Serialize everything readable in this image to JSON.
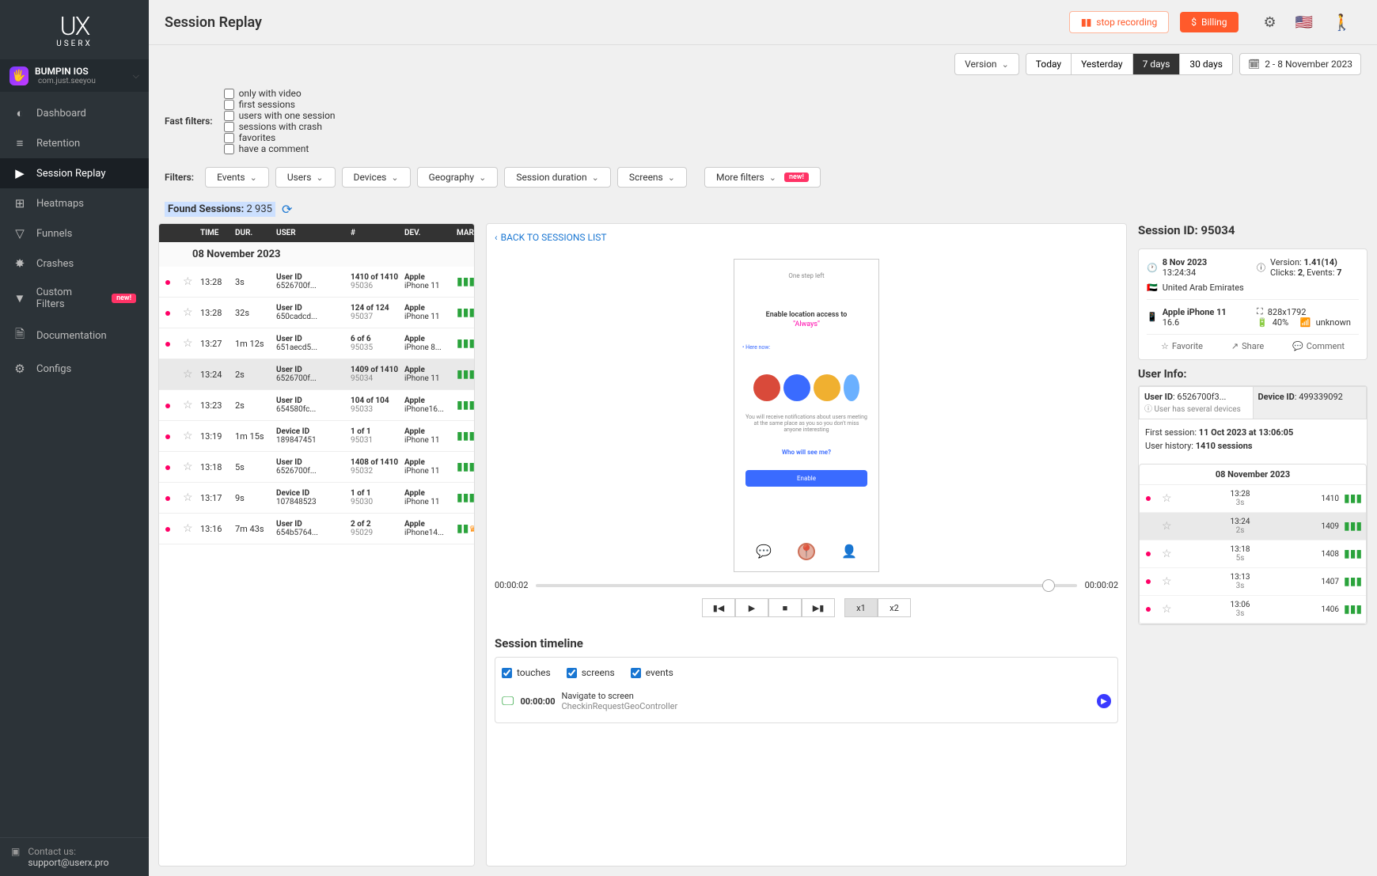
{
  "logo": {
    "mark": "UX",
    "text": "USERX"
  },
  "appSelector": {
    "name": "BUMPIN IOS",
    "bundle": "com.just.seeyou",
    "platformIcon": ""
  },
  "nav": [
    {
      "icon": "◐",
      "label": "Dashboard"
    },
    {
      "icon": "≡",
      "label": "Retention"
    },
    {
      "icon": "▶",
      "label": "Session Replay",
      "active": true
    },
    {
      "icon": "⊞",
      "label": "Heatmaps"
    },
    {
      "icon": "▽",
      "label": "Funnels"
    },
    {
      "icon": "✸",
      "label": "Crashes"
    },
    {
      "icon": "▼",
      "label": "Custom Filters",
      "badge": "new!"
    },
    {
      "icon": "🗎",
      "label": "Documentation"
    },
    {
      "icon": "⚙",
      "label": "Configs"
    }
  ],
  "support": {
    "label": "Contact us:",
    "email": "support@userx.pro"
  },
  "header": {
    "title": "Session Replay",
    "stop": "stop recording",
    "billing": "Billing"
  },
  "versionLabel": "Version",
  "dateRange": {
    "options": [
      "Today",
      "Yesterday",
      "7 days",
      "30 days"
    ],
    "active": "7 days",
    "custom": "2 - 8 November 2023"
  },
  "fastFilters": {
    "label": "Fast filters:",
    "items": [
      "only with video",
      "first sessions",
      "users with one session",
      "sessions with crash",
      "favorites",
      "have a comment"
    ]
  },
  "filters": {
    "label": "Filters:",
    "items": [
      "Events",
      "Users",
      "Devices",
      "Geography",
      "Session duration",
      "Screens"
    ],
    "more": "More filters",
    "moreBadge": "new!"
  },
  "found": {
    "label": "Found Sessions:",
    "count": "2 935"
  },
  "tableHead": [
    "",
    "",
    "TIME",
    "DUR.",
    "USER",
    "#",
    "DEV.",
    "MARKS"
  ],
  "dateHeader": "08 November 2023",
  "sessions": [
    {
      "dot": true,
      "time": "13:28",
      "dur": "3s",
      "uidLabel": "User ID",
      "uid": "6526700f...",
      "num": "1410 of 1410",
      "sid": "95036",
      "brand": "Apple",
      "dev": "iPhone 11"
    },
    {
      "dot": true,
      "time": "13:28",
      "dur": "32s",
      "uidLabel": "User ID",
      "uid": "650cadcd...",
      "num": "124 of 124",
      "sid": "95037",
      "brand": "Apple",
      "dev": "iPhone 11"
    },
    {
      "dot": true,
      "time": "13:27",
      "dur": "1m 12s",
      "uidLabel": "User ID",
      "uid": "651aecd5...",
      "num": "6 of 6",
      "sid": "95035",
      "brand": "Apple",
      "dev": "iPhone 8..."
    },
    {
      "dot": false,
      "time": "13:24",
      "dur": "2s",
      "uidLabel": "User ID",
      "uid": "6526700f...",
      "num": "1409 of 1410",
      "sid": "95034",
      "brand": "Apple",
      "dev": "iPhone 11",
      "selected": true
    },
    {
      "dot": true,
      "time": "13:23",
      "dur": "2s",
      "uidLabel": "User ID",
      "uid": "654580fc...",
      "num": "104 of 104",
      "sid": "95033",
      "brand": "Apple",
      "dev": "iPhone16..."
    },
    {
      "dot": true,
      "time": "13:19",
      "dur": "1m 15s",
      "uidLabel": "Device ID",
      "uid": "189847451",
      "num": "1 of 1",
      "sid": "95031",
      "brand": "Apple",
      "dev": "iPhone 11"
    },
    {
      "dot": true,
      "time": "13:18",
      "dur": "5s",
      "uidLabel": "User ID",
      "uid": "6526700f...",
      "num": "1408 of 1410",
      "sid": "95032",
      "brand": "Apple",
      "dev": "iPhone 11"
    },
    {
      "dot": true,
      "time": "13:17",
      "dur": "9s",
      "uidLabel": "Device ID",
      "uid": "107848523",
      "num": "1 of 1",
      "sid": "95030",
      "brand": "Apple",
      "dev": "iPhone 11"
    },
    {
      "dot": true,
      "time": "13:16",
      "dur": "7m 43s",
      "uidLabel": "User ID",
      "uid": "654b5764...",
      "num": "2 of 2",
      "sid": "95029",
      "brand": "Apple",
      "dev": "iPhone14...",
      "marks": "multi"
    }
  ],
  "player": {
    "back": "BACK TO SESSIONS LIST",
    "cur": "00:00:02",
    "total": "00:00:02",
    "speeds": [
      "x1",
      "x2"
    ],
    "phone": {
      "step": "One step left",
      "title": "Enable location access to",
      "always": "\"Always\"",
      "here": "• Here now:",
      "desc": "You will receive notifications about users meeting at the same place as you so you don't miss anyone interesting",
      "who": "Who will see me?",
      "enable": "Enable"
    }
  },
  "timeline": {
    "title": "Session timeline",
    "checks": [
      "touches",
      "screens",
      "events"
    ],
    "items": [
      {
        "t": "00:00:00",
        "text": "Navigate to screen",
        "sub": "CheckinRequestGeoController"
      }
    ]
  },
  "sessionInfo": {
    "title": "Session ID: 95034",
    "date": "8 Nov 2023",
    "time": "13:24:34",
    "versionLabel": "Version:",
    "version": "1.41(14)",
    "clicksLabel": "Clicks:",
    "clicks": "2",
    "eventsLabel": "Events:",
    "events": "7",
    "country": "United Arab Emirates",
    "device": "Apple iPhone 11",
    "os": "16.6",
    "res": "828x1792",
    "battery": "40%",
    "network": "unknown",
    "actions": [
      "Favorite",
      "Share",
      "Comment"
    ]
  },
  "userInfo": {
    "title": "User Info:",
    "userIdLabel": "User ID",
    "userId": "6526700f3...",
    "deviceIdLabel": "Device ID",
    "deviceId": "499339092",
    "multi": "User has several devices",
    "firstLabel": "First session:",
    "first": "11 Oct 2023 at 13:06:05",
    "histLabel": "User history:",
    "hist": "1410 sessions",
    "miniDate": "08 November 2023",
    "mini": [
      {
        "dot": true,
        "time": "13:28",
        "dur": "3s",
        "num": "1410"
      },
      {
        "dot": false,
        "time": "13:24",
        "dur": "2s",
        "num": "1409",
        "sel": true
      },
      {
        "dot": true,
        "time": "13:18",
        "dur": "5s",
        "num": "1408"
      },
      {
        "dot": true,
        "time": "13:13",
        "dur": "3s",
        "num": "1407"
      },
      {
        "dot": true,
        "time": "13:06",
        "dur": "3s",
        "num": "1406"
      }
    ]
  }
}
